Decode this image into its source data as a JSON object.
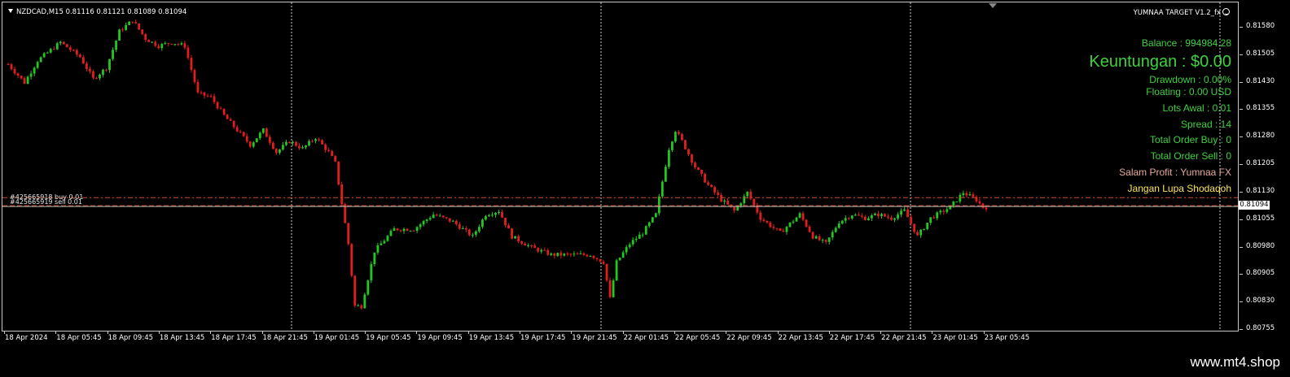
{
  "header": {
    "symbol_info": "NZDCAD,M15  0.81116 0.81121 0.81089 0.81094",
    "ea_title": "YUMNAA TARGET V1.2_fx"
  },
  "panel": {
    "balance": "Balance : 994984.28",
    "keuntungan": "Keuntungan : $0.00",
    "drawdown": "Drawdown  : 0.00%",
    "floating": "Floating : 0.00 USD",
    "lots_awal": "Lots Awal : 0.01",
    "spread": "Spread : 14",
    "total_buy": "Total Order Buy  : 0",
    "total_sell": "Total Order Sell  : 0",
    "salam": "Salam Profit : Yumnaa FX",
    "shodaqoh": "Jangan Lupa Shodaqoh"
  },
  "orders": {
    "buy_label": "#425665918 buy 0.01",
    "sell_label": "#425665919 sell 0.01",
    "buy_price": 0.81116,
    "sell_price": 0.81094
  },
  "price_axis": {
    "labels": [
      "0.81580",
      "0.81505",
      "0.81430",
      "0.81355",
      "0.81280",
      "0.81205",
      "0.81130",
      "0.81055",
      "0.80980",
      "0.80905",
      "0.80830",
      "0.80755"
    ],
    "current": "0.81094"
  },
  "time_axis": {
    "labels": [
      "18 Apr 2024",
      "18 Apr 05:45",
      "18 Apr 09:45",
      "18 Apr 13:45",
      "18 Apr 17:45",
      "18 Apr 21:45",
      "19 Apr 01:45",
      "19 Apr 05:45",
      "19 Apr 09:45",
      "19 Apr 13:45",
      "19 Apr 17:45",
      "19 Apr 21:45",
      "22 Apr 01:45",
      "22 Apr 05:45",
      "22 Apr 09:45",
      "22 Apr 13:45",
      "22 Apr 17:45",
      "22 Apr 21:45",
      "23 Apr 01:45",
      "23 Apr 05:45"
    ]
  },
  "colors": {
    "bull": "#22c722",
    "bear": "#e11d1d",
    "text_green": "#3dd23d",
    "order_line": "#d04a2a"
  },
  "brand": "www.mt4.shop",
  "chart_data": {
    "type": "candlestick",
    "symbol": "NZDCAD",
    "timeframe": "M15",
    "last_bar": {
      "open": 0.81116,
      "high": 0.81121,
      "low": 0.81089,
      "close": 0.81094
    },
    "ylim": [
      0.80755,
      0.8158
    ],
    "close_path": [
      [
        0,
        0.8148
      ],
      [
        5,
        0.8143
      ],
      [
        9,
        0.8149
      ],
      [
        16,
        0.8154
      ],
      [
        22,
        0.815
      ],
      [
        26,
        0.8144
      ],
      [
        30,
        0.8147
      ],
      [
        34,
        0.8157
      ],
      [
        38,
        0.816
      ],
      [
        42,
        0.8155
      ],
      [
        46,
        0.8153
      ],
      [
        50,
        0.8154
      ],
      [
        54,
        0.8153
      ],
      [
        58,
        0.814
      ],
      [
        62,
        0.8139
      ],
      [
        66,
        0.8134
      ],
      [
        70,
        0.813
      ],
      [
        74,
        0.8126
      ],
      [
        78,
        0.813
      ],
      [
        82,
        0.8124
      ],
      [
        86,
        0.8127
      ],
      [
        90,
        0.8125
      ],
      [
        94,
        0.8128
      ],
      [
        98,
        0.8124
      ],
      [
        100,
        0.8121
      ],
      [
        104,
        0.8099
      ],
      [
        106,
        0.8082
      ],
      [
        108,
        0.8082
      ],
      [
        112,
        0.8097
      ],
      [
        118,
        0.8103
      ],
      [
        124,
        0.8103
      ],
      [
        130,
        0.8107
      ],
      [
        136,
        0.8105
      ],
      [
        142,
        0.8101
      ],
      [
        146,
        0.8107
      ],
      [
        150,
        0.8108
      ],
      [
        154,
        0.8101
      ],
      [
        160,
        0.8098
      ],
      [
        166,
        0.8096
      ],
      [
        172,
        0.8096
      ],
      [
        178,
        0.8096
      ],
      [
        182,
        0.8094
      ],
      [
        184,
        0.8084
      ],
      [
        186,
        0.8094
      ],
      [
        190,
        0.8099
      ],
      [
        194,
        0.8102
      ],
      [
        198,
        0.8107
      ],
      [
        202,
        0.8125
      ],
      [
        204,
        0.813
      ],
      [
        206,
        0.8127
      ],
      [
        210,
        0.812
      ],
      [
        214,
        0.8115
      ],
      [
        218,
        0.8111
      ],
      [
        222,
        0.8108
      ],
      [
        226,
        0.8113
      ],
      [
        230,
        0.8106
      ],
      [
        236,
        0.8102
      ],
      [
        242,
        0.8107
      ],
      [
        246,
        0.8101
      ],
      [
        250,
        0.8099
      ],
      [
        254,
        0.8105
      ],
      [
        258,
        0.8107
      ],
      [
        262,
        0.8106
      ],
      [
        266,
        0.8107
      ],
      [
        270,
        0.8106
      ],
      [
        274,
        0.8108
      ],
      [
        278,
        0.8101
      ],
      [
        282,
        0.8106
      ],
      [
        288,
        0.8109
      ],
      [
        292,
        0.8113
      ],
      [
        296,
        0.8111
      ],
      [
        298,
        0.8109
      ]
    ]
  }
}
